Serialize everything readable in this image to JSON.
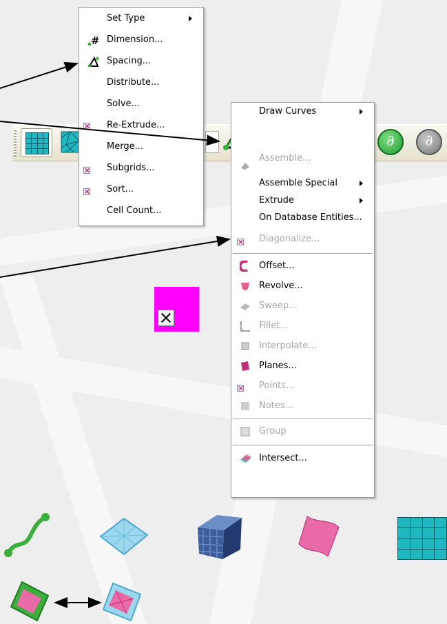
{
  "left_menu": {
    "items": [
      {
        "label": "Set Type",
        "icon": "",
        "submenu": true,
        "disabled": false
      },
      {
        "label": "Dimension...",
        "icon": "dimension-hash-icon",
        "submenu": false,
        "disabled": false
      },
      {
        "label": "Spacing...",
        "icon": "spacing-triangle-icon",
        "submenu": false,
        "disabled": false
      },
      {
        "label": "Distribute...",
        "icon": "",
        "submenu": false,
        "disabled": false
      },
      {
        "label": "Solve...",
        "icon": "",
        "submenu": false,
        "disabled": false
      },
      {
        "label": "Re-Extrude...",
        "icon": "missing-image-icon",
        "submenu": false,
        "disabled": false
      },
      {
        "label": "Merge...",
        "icon": "",
        "submenu": false,
        "disabled": false
      },
      {
        "label": "Subgrids...",
        "icon": "missing-image-icon",
        "submenu": false,
        "disabled": false
      },
      {
        "label": "Sort...",
        "icon": "missing-image-icon",
        "submenu": false,
        "disabled": false
      },
      {
        "label": "Cell Count...",
        "icon": "",
        "submenu": false,
        "disabled": false
      }
    ]
  },
  "right_menu": {
    "items": [
      {
        "label": "Draw Curves",
        "icon": "",
        "submenu": true,
        "disabled": false
      },
      {
        "label": "Assemble...",
        "icon": "assemble-icon",
        "submenu": false,
        "disabled": true
      },
      {
        "label": "Assemble Special",
        "icon": "",
        "submenu": true,
        "disabled": false
      },
      {
        "label": "Extrude",
        "icon": "",
        "submenu": true,
        "disabled": false
      },
      {
        "label": "On Database Entities...",
        "icon": "",
        "submenu": false,
        "disabled": false
      },
      {
        "label": "Diagonalize...",
        "icon": "missing-image-icon",
        "submenu": false,
        "disabled": true
      },
      {
        "label": "Offset...",
        "icon": "offset-icon",
        "submenu": false,
        "disabled": false
      },
      {
        "label": "Revolve...",
        "icon": "revolve-icon",
        "submenu": false,
        "disabled": false
      },
      {
        "label": "Sweep...",
        "icon": "sweep-icon",
        "submenu": false,
        "disabled": true
      },
      {
        "label": "Fillet...",
        "icon": "fillet-icon",
        "submenu": false,
        "disabled": true
      },
      {
        "label": "Interpolate...",
        "icon": "interpolate-icon",
        "submenu": false,
        "disabled": true
      },
      {
        "label": "Planes...",
        "icon": "planes-icon",
        "submenu": false,
        "disabled": false
      },
      {
        "label": "Points...",
        "icon": "points-icon",
        "submenu": false,
        "disabled": true
      },
      {
        "label": "Notes...",
        "icon": "notes-icon",
        "submenu": false,
        "disabled": true
      },
      {
        "label": "Group",
        "icon": "group-icon",
        "submenu": false,
        "disabled": true
      },
      {
        "label": "Intersect...",
        "icon": "intersect-icon",
        "submenu": false,
        "disabled": false
      }
    ]
  },
  "toolbar": {
    "buttons": [
      "structured-grid-icon",
      "unstructured-grid-icon",
      "spacing-triangle-icon",
      "combo-box",
      "create-database-icon",
      "partial-derivative-green-icon",
      "partial-derivative-gray-icon"
    ],
    "combo_value": ""
  },
  "bottom_icons": [
    "connector-curve-icon",
    "unstructured-domain-icon",
    "block-icon",
    "domain-surface-icon",
    "structured-domain-icon",
    "structured-domain-green-icon",
    "unstructured-domain-pink-icon"
  ],
  "colors": {
    "teal": "#1fb7c0",
    "pink": "#e86aa6",
    "magenta_box": "#ff00ff",
    "green": "#3cae3c",
    "menu_disabled": "#a5a5a5"
  }
}
